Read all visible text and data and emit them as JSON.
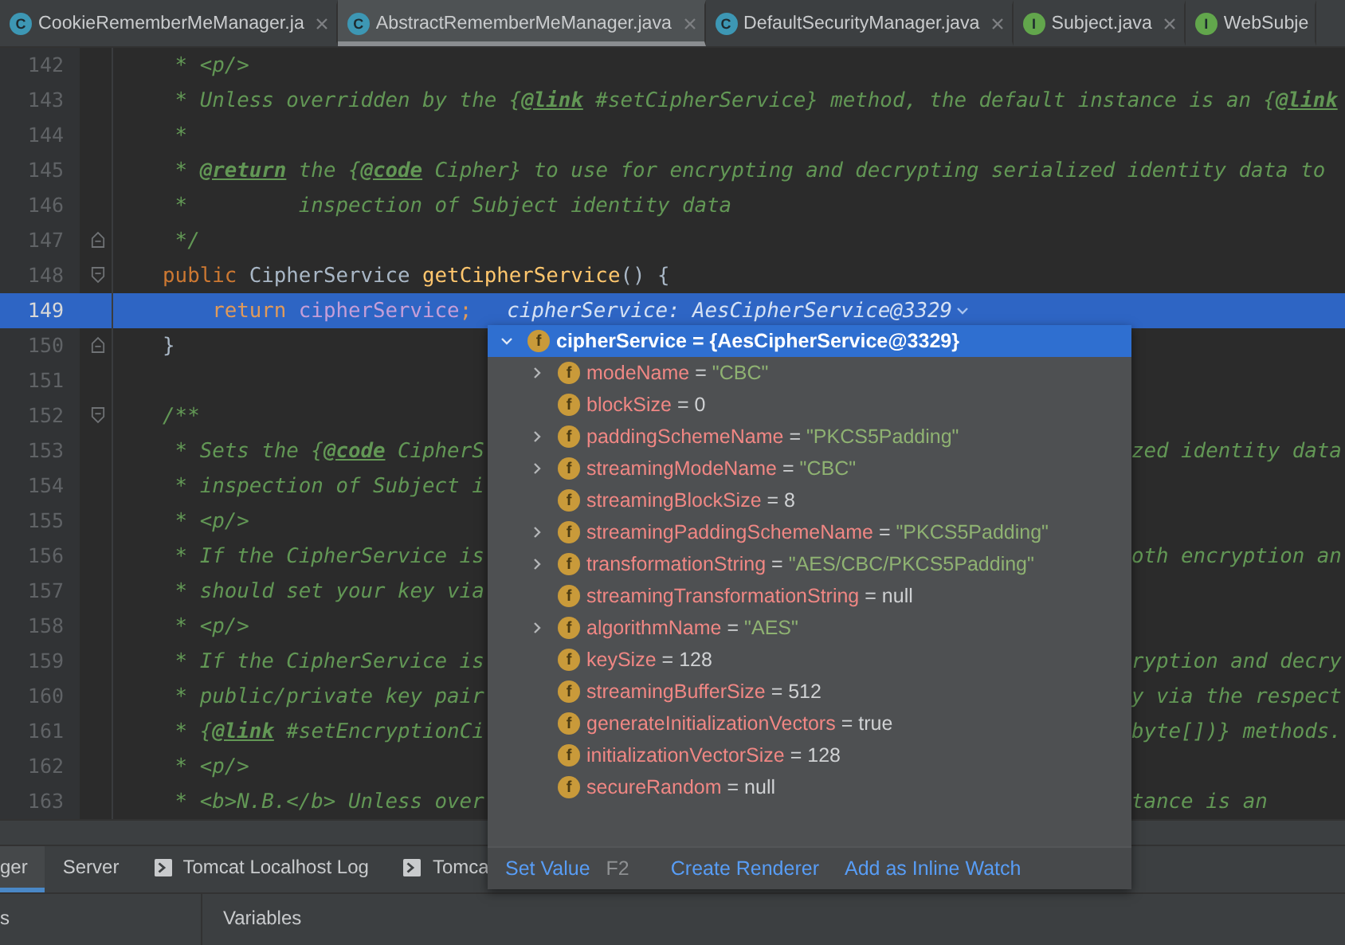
{
  "tabs": [
    {
      "badge": "C",
      "kind": "class",
      "label": "CookieRememberMeManager.ja",
      "selected": false,
      "closable": true
    },
    {
      "badge": "C",
      "kind": "class",
      "label": "AbstractRememberMeManager.java",
      "selected": true,
      "closable": true
    },
    {
      "badge": "C",
      "kind": "class",
      "label": "DefaultSecurityManager.java",
      "selected": false,
      "closable": true
    },
    {
      "badge": "I",
      "kind": "interface",
      "label": "Subject.java",
      "selected": false,
      "closable": true
    },
    {
      "badge": "I",
      "kind": "interface",
      "label": "WebSubje",
      "selected": false,
      "closable": false
    }
  ],
  "editor": {
    "lines": [
      {
        "number": "142",
        "tokens": [
          {
            "kind": "comment",
            "text": "     * <p/>"
          }
        ]
      },
      {
        "number": "143",
        "tokens": [
          {
            "kind": "comment",
            "text": "     * Unless overridden by the {"
          },
          {
            "kind": "tag",
            "text": "@link"
          },
          {
            "kind": "comment",
            "text": " #setCipherService} method, the default instance is an {"
          },
          {
            "kind": "tag",
            "text": "@link"
          }
        ]
      },
      {
        "number": "144",
        "tokens": [
          {
            "kind": "comment",
            "text": "     *"
          }
        ]
      },
      {
        "number": "145",
        "tokens": [
          {
            "kind": "comment",
            "text": "     * "
          },
          {
            "kind": "tag",
            "text": "@return"
          },
          {
            "kind": "comment",
            "text": " the {"
          },
          {
            "kind": "tag",
            "text": "@code"
          },
          {
            "kind": "comment",
            "text": " Cipher} to use for encrypting and decrypting serialized identity data to"
          }
        ]
      },
      {
        "number": "146",
        "tokens": [
          {
            "kind": "comment",
            "text": "     *         inspection of Subject identity data"
          }
        ]
      },
      {
        "number": "147",
        "fold_end": true,
        "tokens": [
          {
            "kind": "comment",
            "text": "     */"
          }
        ]
      },
      {
        "number": "148",
        "fold_start": true,
        "tokens": [
          {
            "kind": "keyword",
            "text": "    public "
          },
          {
            "kind": "plain",
            "text": "CipherService "
          },
          {
            "kind": "method",
            "text": "getCipherService"
          },
          {
            "kind": "plain",
            "text": "() {"
          }
        ]
      },
      {
        "number": "149",
        "current": true,
        "tokens": [
          {
            "kind": "keyword",
            "text": "        return "
          },
          {
            "kind": "field",
            "text": "cipherService"
          },
          {
            "kind": "keyword",
            "text": ";"
          }
        ],
        "hint": "cipherService: AesCipherService@3329"
      },
      {
        "number": "150",
        "fold_end": true,
        "tokens": [
          {
            "kind": "plain",
            "text": "    }"
          }
        ]
      },
      {
        "number": "151"
      },
      {
        "number": "152",
        "fold_start": true,
        "tokens": [
          {
            "kind": "comment",
            "text": "    /**"
          }
        ]
      },
      {
        "number": "153",
        "tokens": [
          {
            "kind": "comment",
            "text": "     * Sets the {"
          },
          {
            "kind": "tag",
            "text": "@code"
          },
          {
            "kind": "comment",
            "text": " CipherS"
          }
        ],
        "tail": "zed identity data"
      },
      {
        "number": "154",
        "tokens": [
          {
            "kind": "comment",
            "text": "     * inspection of Subject i"
          }
        ]
      },
      {
        "number": "155",
        "tokens": [
          {
            "kind": "comment",
            "text": "     * <p/>"
          }
        ]
      },
      {
        "number": "156",
        "tokens": [
          {
            "kind": "comment",
            "text": "     * If the CipherService is"
          }
        ],
        "tail": "oth encryption an"
      },
      {
        "number": "157",
        "tokens": [
          {
            "kind": "comment",
            "text": "     * should set your key via"
          }
        ]
      },
      {
        "number": "158",
        "tokens": [
          {
            "kind": "comment",
            "text": "     * <p/>"
          }
        ]
      },
      {
        "number": "159",
        "tokens": [
          {
            "kind": "comment",
            "text": "     * If the CipherService is"
          }
        ],
        "tail": "ryption and decry"
      },
      {
        "number": "160",
        "tokens": [
          {
            "kind": "comment",
            "text": "     * public/private key pair"
          }
        ],
        "tail": "y via the respect"
      },
      {
        "number": "161",
        "tokens": [
          {
            "kind": "comment",
            "text": "     * {"
          },
          {
            "kind": "tag",
            "text": "@link"
          },
          {
            "kind": "comment",
            "text": " #setEncryptionCi"
          }
        ],
        "tail": "byte[])} methods."
      },
      {
        "number": "162",
        "tokens": [
          {
            "kind": "comment",
            "text": "     * <p/>"
          }
        ]
      },
      {
        "number": "163",
        "tokens": [
          {
            "kind": "comment",
            "text": "     * <b>N.B.</b> Unless over"
          }
        ],
        "tail": "tance is an"
      }
    ]
  },
  "popup": {
    "root": {
      "badge": "f",
      "name": "cipherService",
      "eq": "=",
      "value": "{AesCipherService@3329}",
      "expanded": true
    },
    "fields": [
      {
        "badge": "f",
        "name": "modeName",
        "eq": "=",
        "value": "\"CBC\"",
        "kind": "string",
        "expandable": true
      },
      {
        "badge": "f",
        "name": "blockSize",
        "eq": "=",
        "value": "0",
        "kind": "plain",
        "expandable": false
      },
      {
        "badge": "f",
        "name": "paddingSchemeName",
        "eq": "=",
        "value": "\"PKCS5Padding\"",
        "kind": "string",
        "expandable": true
      },
      {
        "badge": "f",
        "name": "streamingModeName",
        "eq": "=",
        "value": "\"CBC\"",
        "kind": "string",
        "expandable": true
      },
      {
        "badge": "f",
        "name": "streamingBlockSize",
        "eq": "=",
        "value": "8",
        "kind": "plain",
        "expandable": false
      },
      {
        "badge": "f",
        "name": "streamingPaddingSchemeName",
        "eq": "=",
        "value": "\"PKCS5Padding\"",
        "kind": "string",
        "expandable": true
      },
      {
        "badge": "f",
        "name": "transformationString",
        "eq": "=",
        "value": "\"AES/CBC/PKCS5Padding\"",
        "kind": "string",
        "expandable": true
      },
      {
        "badge": "f",
        "name": "streamingTransformationString",
        "eq": "=",
        "value": "null",
        "kind": "plain",
        "expandable": false
      },
      {
        "badge": "f",
        "name": "algorithmName",
        "eq": "=",
        "value": "\"AES\"",
        "kind": "string",
        "expandable": true
      },
      {
        "badge": "f",
        "name": "keySize",
        "eq": "=",
        "value": "128",
        "kind": "plain",
        "expandable": false
      },
      {
        "badge": "f",
        "name": "streamingBufferSize",
        "eq": "=",
        "value": "512",
        "kind": "plain",
        "expandable": false
      },
      {
        "badge": "f",
        "name": "generateInitializationVectors",
        "eq": "=",
        "value": "true",
        "kind": "plain",
        "expandable": false
      },
      {
        "badge": "f",
        "name": "initializationVectorSize",
        "eq": "=",
        "value": "128",
        "kind": "plain",
        "expandable": false
      },
      {
        "badge": "f",
        "name": "secureRandom",
        "eq": "=",
        "value": "null",
        "kind": "plain",
        "expandable": false
      }
    ],
    "actions": [
      {
        "label": "Set Value",
        "shortcut": "F2"
      },
      {
        "label": "Create Renderer"
      },
      {
        "label": "Add as Inline Watch"
      }
    ]
  },
  "debug_tabs": [
    {
      "label": "ger",
      "selected": true,
      "icon": false
    },
    {
      "label": "Server",
      "selected": false,
      "icon": false
    },
    {
      "label": "Tomcat Localhost Log",
      "selected": false,
      "icon": true
    },
    {
      "label": "Tomca",
      "selected": false,
      "icon": true
    }
  ],
  "panels": {
    "left": "s",
    "variables": "Variables"
  }
}
